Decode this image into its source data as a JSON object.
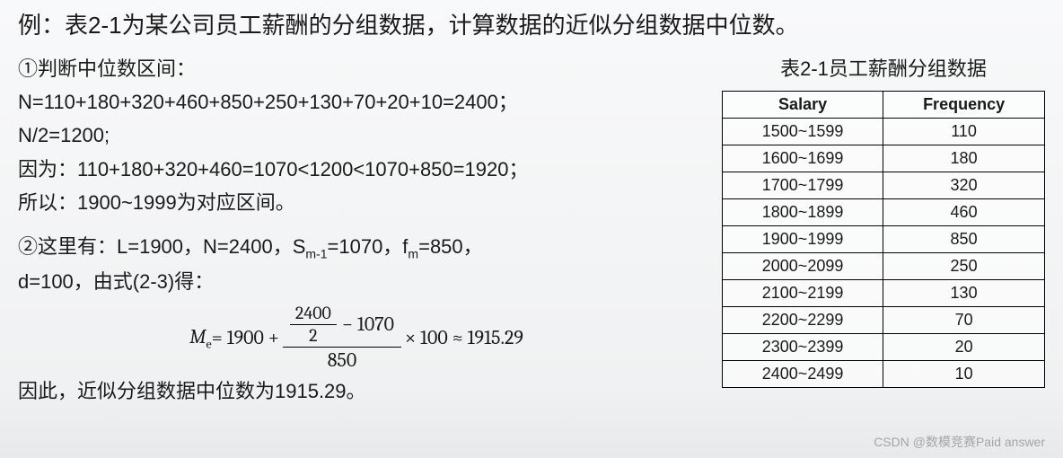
{
  "title": "例：表2-1为某公司员工薪酬的分组数据，计算数据的近似分组数据中位数。",
  "step1": {
    "heading": "①判断中位数区间：",
    "line_n": "N=110+180+320+460+850+250+130+70+20+10=2400；",
    "line_nhalf": "N/2=1200;",
    "line_because": "因为：110+180+320+460=1070<1200<1070+850=1920；",
    "line_so": "所以：1900~1999为对应区间。"
  },
  "step2": {
    "heading_prefix": "②这里有：L=1900，N=2400，S",
    "heading_sub": "m-1",
    "heading_mid": "=1070，f",
    "heading_sub2": "m",
    "heading_suffix": "=850，",
    "line_d": "d=100，由式(2-3)得：",
    "formula": {
      "me": "M",
      "me_sub": "e",
      "eq": " = 1900 + ",
      "top_frac_num": "2400",
      "top_frac_den": "2",
      "minus": " − 1070",
      "den": "850",
      "tail": " × 100 ≈ 1915.29"
    },
    "conclusion": "因此，近似分组数据中位数为1915.29。"
  },
  "table": {
    "caption": "表2-1员工薪酬分组数据",
    "headers": [
      "Salary",
      "Frequency"
    ],
    "rows": [
      [
        "1500~1599",
        "110"
      ],
      [
        "1600~1699",
        "180"
      ],
      [
        "1700~1799",
        "320"
      ],
      [
        "1800~1899",
        "460"
      ],
      [
        "1900~1999",
        "850"
      ],
      [
        "2000~2099",
        "250"
      ],
      [
        "2100~2199",
        "130"
      ],
      [
        "2200~2299",
        "70"
      ],
      [
        "2300~2399",
        "20"
      ],
      [
        "2400~2499",
        "10"
      ]
    ]
  },
  "watermark": "CSDN @数模竞赛Paid answer"
}
